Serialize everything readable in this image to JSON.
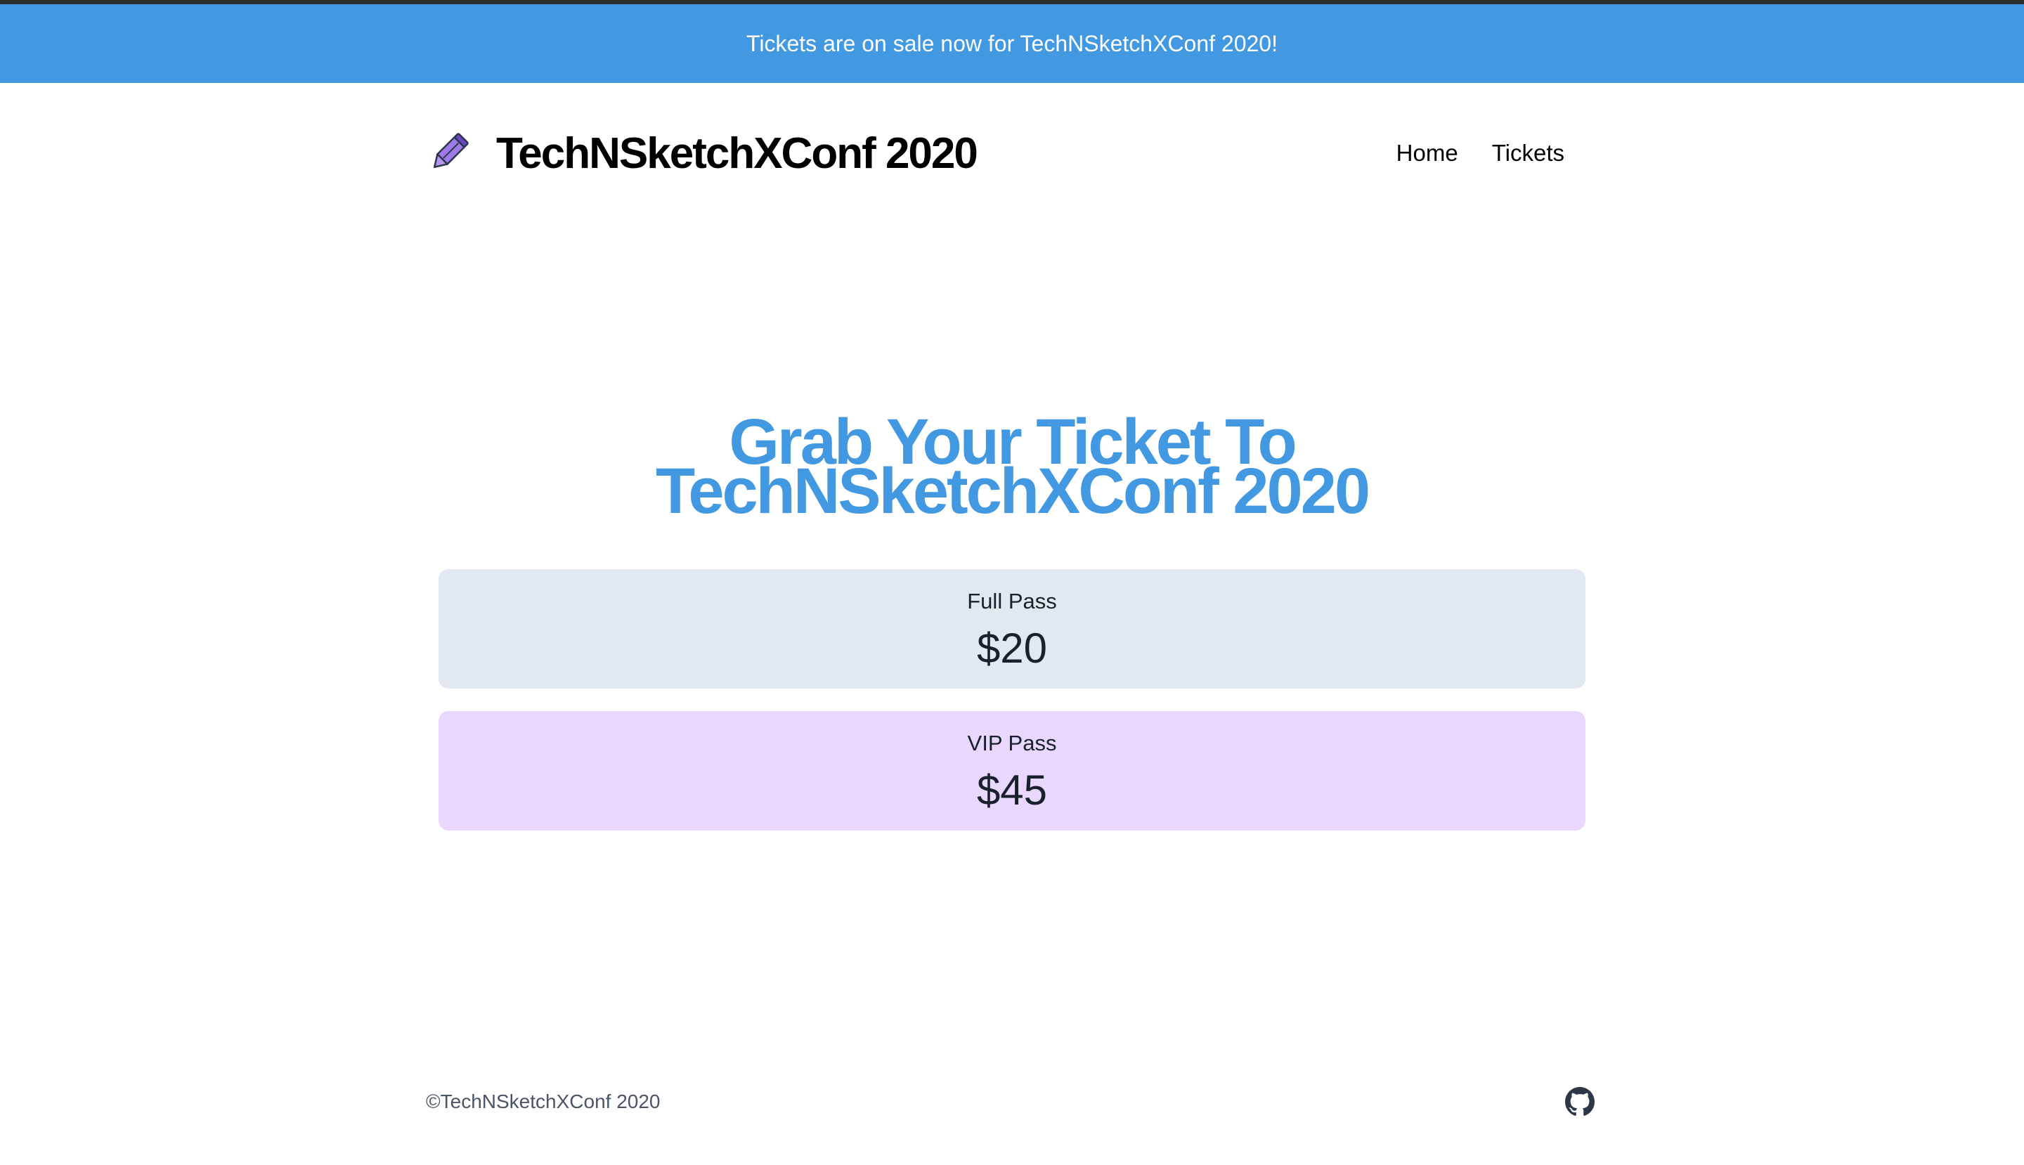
{
  "banner": {
    "text": "Tickets are on sale now for TechNSketchXConf 2020!"
  },
  "header": {
    "logo_icon": "pencil-icon",
    "title": "TechNSketchXConf 2020",
    "nav": [
      {
        "label": "Home"
      },
      {
        "label": "Tickets"
      }
    ]
  },
  "hero": {
    "line1": "Grab Your Ticket To",
    "line2": "TechNSketchXConf 2020"
  },
  "tickets": [
    {
      "name": "Full Pass",
      "price": "$20",
      "color": "#e2e8f0"
    },
    {
      "name": "VIP Pass",
      "price": "$45",
      "color": "#e9d8fd"
    }
  ],
  "footer": {
    "copyright": "©TechNSketchXConf 2020",
    "icon": "github-icon"
  },
  "colors": {
    "accent": "#4299e1",
    "text": "#000000"
  }
}
